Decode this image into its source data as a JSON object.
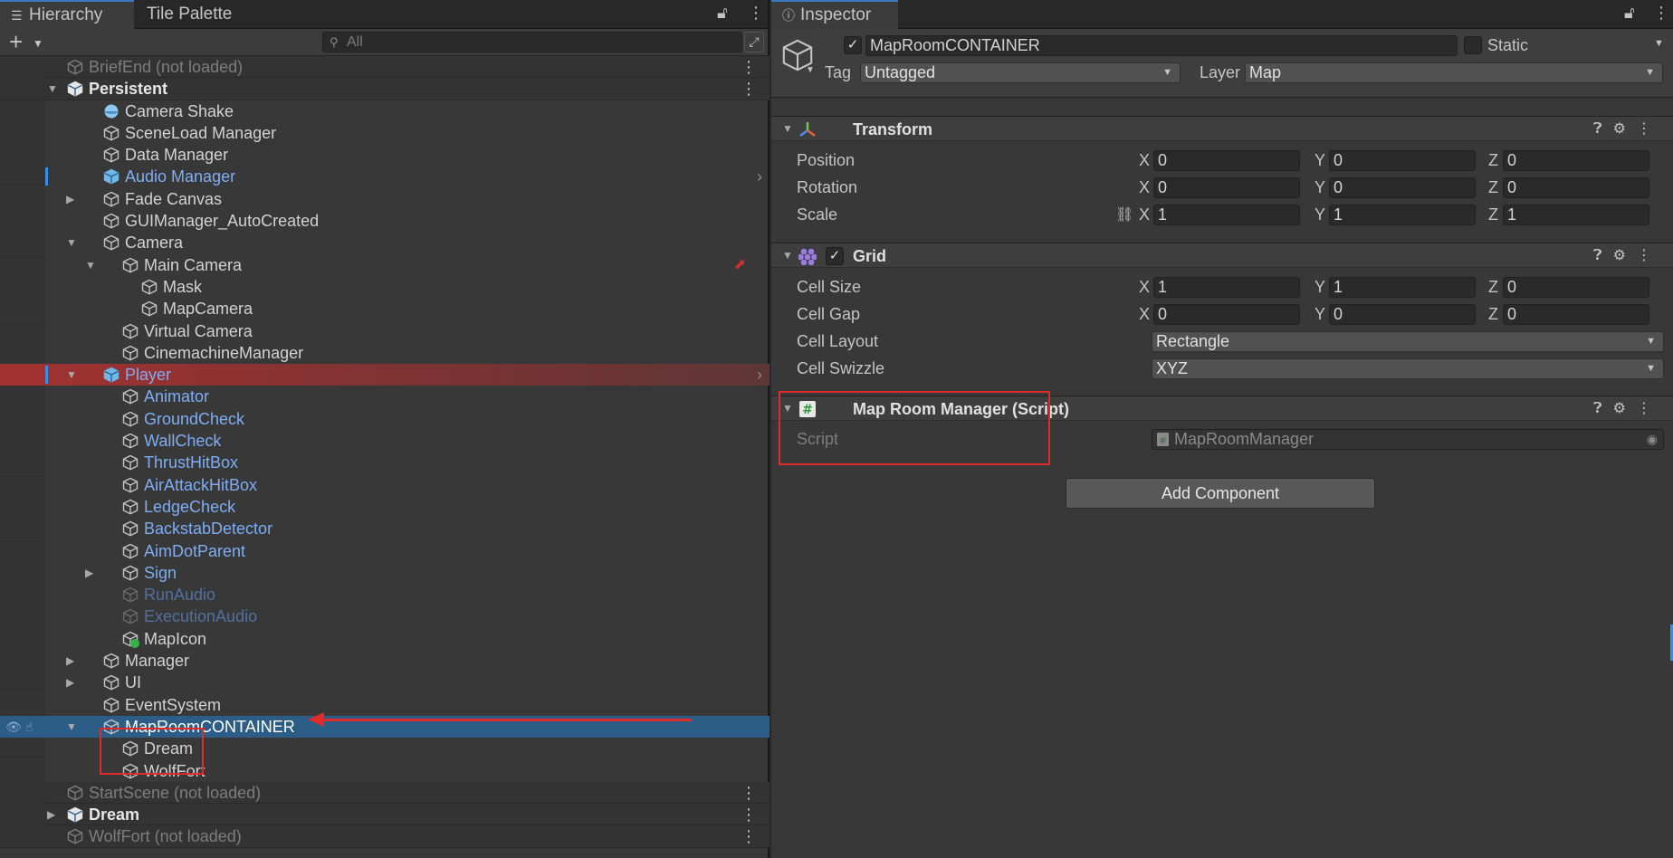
{
  "hierarchy": {
    "tabs": [
      "Hierarchy",
      "Tile Palette"
    ],
    "search_placeholder": "All",
    "rows": [
      {
        "label": "BriefEnd (not loaded)",
        "kind": "scene-unloaded"
      },
      {
        "label": "Persistent",
        "kind": "scene"
      },
      {
        "label": "Camera Shake",
        "kind": "object"
      },
      {
        "label": "SceneLoad Manager",
        "kind": "object"
      },
      {
        "label": "Data Manager",
        "kind": "object"
      },
      {
        "label": "Audio Manager",
        "kind": "prefab"
      },
      {
        "label": "Fade Canvas",
        "kind": "object"
      },
      {
        "label": "GUIManager_AutoCreated",
        "kind": "object"
      },
      {
        "label": "Camera",
        "kind": "object"
      },
      {
        "label": "Main Camera",
        "kind": "object"
      },
      {
        "label": "Mask",
        "kind": "object"
      },
      {
        "label": "MapCamera",
        "kind": "object"
      },
      {
        "label": "Virtual Camera",
        "kind": "object"
      },
      {
        "label": "CinemachineManager",
        "kind": "object"
      },
      {
        "label": "Player",
        "kind": "prefab-root"
      },
      {
        "label": "Animator",
        "kind": "prefab"
      },
      {
        "label": "GroundCheck",
        "kind": "prefab"
      },
      {
        "label": "WallCheck",
        "kind": "prefab"
      },
      {
        "label": "ThrustHitBox",
        "kind": "prefab"
      },
      {
        "label": "AirAttackHitBox",
        "kind": "prefab"
      },
      {
        "label": "LedgeCheck",
        "kind": "prefab"
      },
      {
        "label": "BackstabDetector",
        "kind": "prefab"
      },
      {
        "label": "AimDotParent",
        "kind": "prefab"
      },
      {
        "label": "Sign",
        "kind": "prefab"
      },
      {
        "label": "RunAudio",
        "kind": "prefab-disabled"
      },
      {
        "label": "ExecutionAudio",
        "kind": "prefab-disabled"
      },
      {
        "label": "MapIcon",
        "kind": "object"
      },
      {
        "label": "Manager",
        "kind": "object"
      },
      {
        "label": "UI",
        "kind": "object"
      },
      {
        "label": "EventSystem",
        "kind": "object"
      },
      {
        "label": "MapRoomCONTAINER",
        "kind": "selected"
      },
      {
        "label": "Dream",
        "kind": "object"
      },
      {
        "label": "WolfFort",
        "kind": "object"
      },
      {
        "label": "StartScene (not loaded)",
        "kind": "scene-unloaded"
      },
      {
        "label": "Dream",
        "kind": "scene"
      },
      {
        "label": "WolfFort (not loaded)",
        "kind": "scene-unloaded"
      }
    ]
  },
  "inspector": {
    "tab": "Inspector",
    "object_name": "MapRoomCONTAINER",
    "static_label": "Static",
    "tag_label": "Tag",
    "tag_value": "Untagged",
    "layer_label": "Layer",
    "layer_value": "Map",
    "transform": {
      "title": "Transform",
      "rows": [
        {
          "label": "Position",
          "x": "0",
          "y": "0",
          "z": "0"
        },
        {
          "label": "Rotation",
          "x": "0",
          "y": "0",
          "z": "0"
        },
        {
          "label": "Scale",
          "x": "1",
          "y": "1",
          "z": "1"
        }
      ]
    },
    "grid": {
      "title": "Grid",
      "rows": [
        {
          "label": "Cell Size",
          "x": "1",
          "y": "1",
          "z": "0"
        },
        {
          "label": "Cell Gap",
          "x": "0",
          "y": "0",
          "z": "0"
        }
      ],
      "cell_layout_label": "Cell Layout",
      "cell_layout_value": "Rectangle",
      "cell_swizzle_label": "Cell Swizzle",
      "cell_swizzle_value": "XYZ"
    },
    "script": {
      "title": "Map Room Manager (Script)",
      "script_label": "Script",
      "script_value": "MapRoomManager"
    },
    "add_component": "Add Component",
    "axes": {
      "x": "X",
      "y": "Y",
      "z": "Z"
    }
  },
  "colors": {
    "selection": "#2c5d87",
    "player_row": "#a23232",
    "annotation": "#e02b2b",
    "prefab_text": "#7fadf3"
  }
}
